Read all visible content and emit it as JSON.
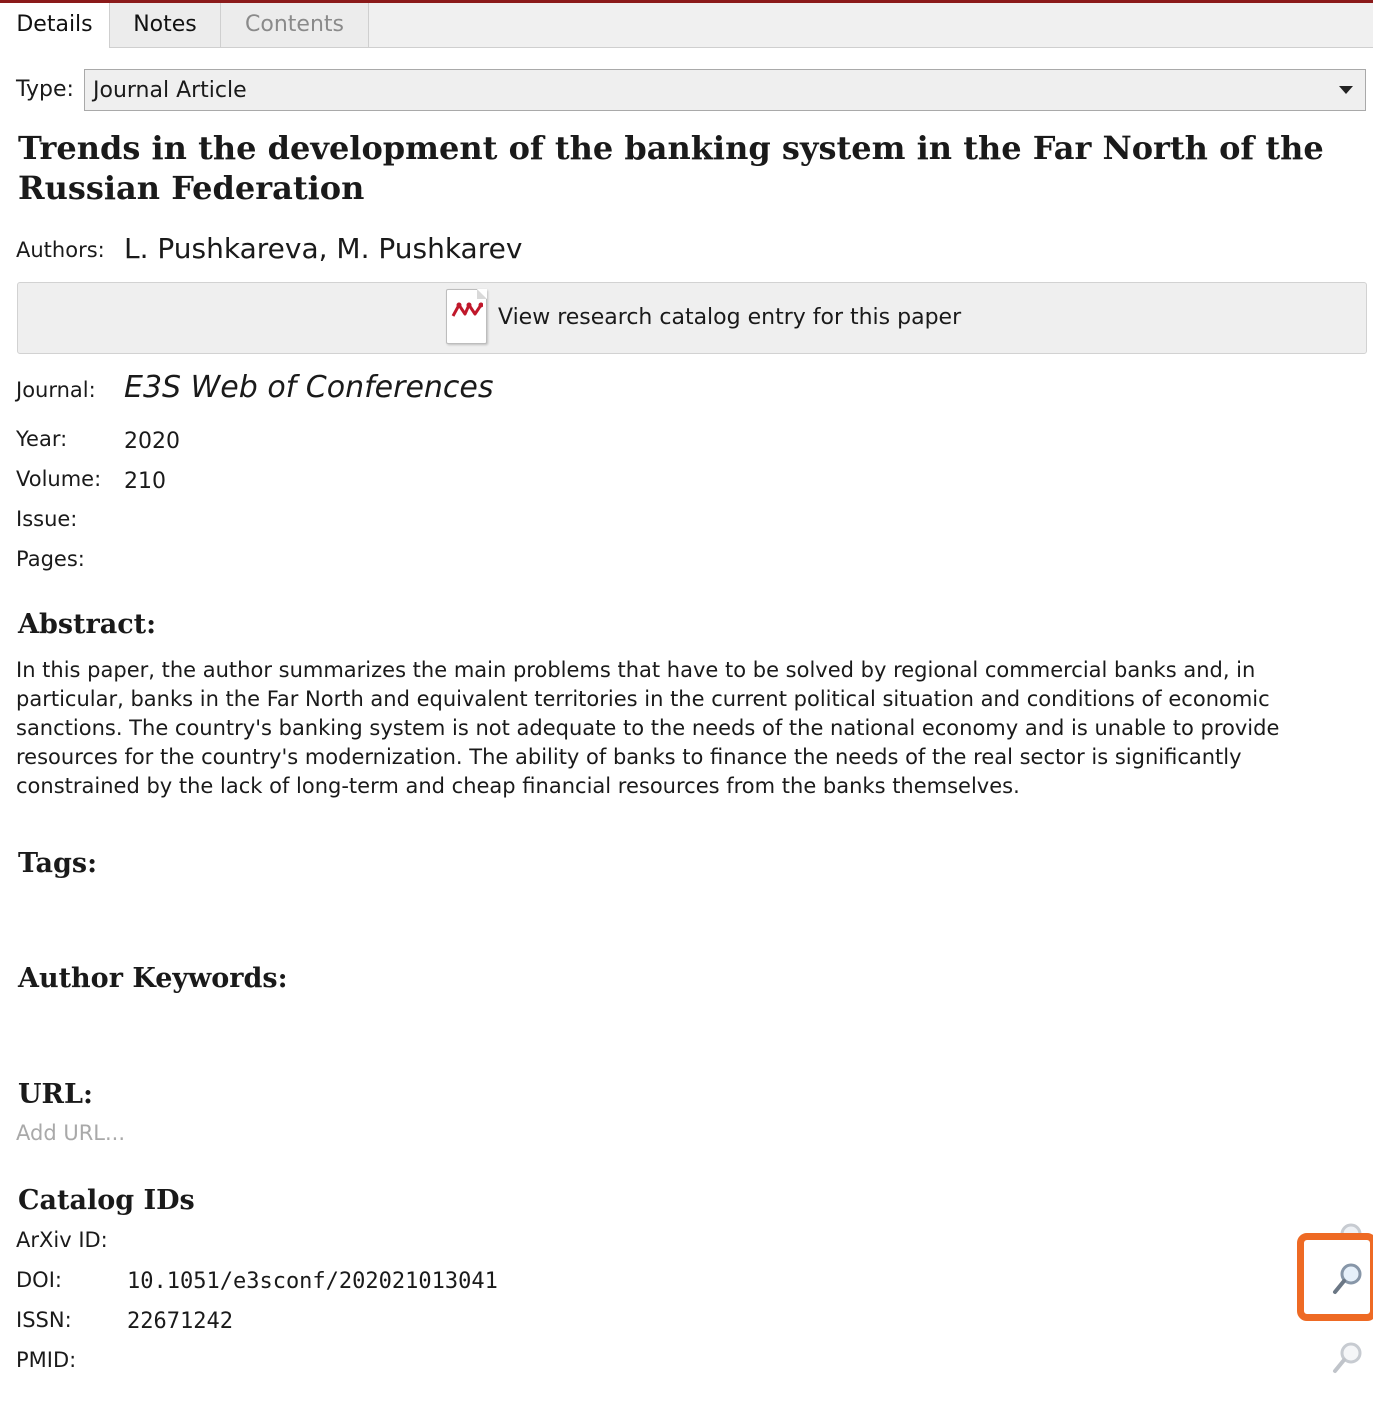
{
  "tabs": [
    {
      "label": "Details"
    },
    {
      "label": "Notes"
    },
    {
      "label": "Contents"
    }
  ],
  "type": {
    "label": "Type:",
    "value": "Journal Article"
  },
  "paper": {
    "title": "Trends in the development of the banking system in the Far North of the Russian Federation",
    "authors_label": "Authors:",
    "authors": "L. Pushkareva, M. Pushkarev"
  },
  "catalog_button": {
    "label": "View research catalog entry for this paper",
    "icon": "research-catalog-icon"
  },
  "fields": {
    "journal_label": "Journal:",
    "journal": "E3S Web of Conferences",
    "year_label": "Year:",
    "year": "2020",
    "volume_label": "Volume:",
    "volume": "210",
    "issue_label": "Issue:",
    "pages_label": "Pages:"
  },
  "abstract": {
    "heading": "Abstract:",
    "text": "In this paper, the author summarizes the main problems that have to be solved by regional commercial banks and, in particular, banks in the Far North and equivalent territories in the current political situation and conditions of economic sanctions. The country's banking system is not adequate to the needs of the national economy and is unable to provide resources for the country's modernization. The ability of banks to finance the needs of the real sector is significantly constrained by the lack of long-term and cheap financial resources from the banks themselves."
  },
  "tags": {
    "heading": "Tags:"
  },
  "author_keywords": {
    "heading": "Author Keywords:"
  },
  "url": {
    "heading": "URL:",
    "placeholder": "Add URL..."
  },
  "catalog_ids": {
    "heading": "Catalog IDs",
    "arxiv_label": "ArXiv ID:",
    "doi_label": "DOI:",
    "doi": "10.1051/e3sconf/202021013041",
    "issn_label": "ISSN:",
    "issn": "22671242",
    "pmid_label": "PMID:"
  },
  "colors": {
    "accent_top_line": "#8b1a1a",
    "highlight": "#ee6a24",
    "icon": "lookup-magnifier-icon"
  }
}
